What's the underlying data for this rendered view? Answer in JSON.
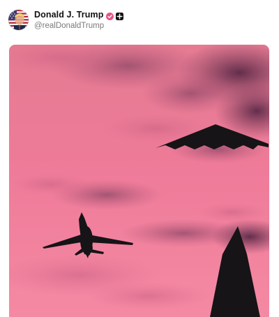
{
  "post": {
    "author": {
      "display_name": "Donald J. Trump",
      "handle": "@realDonaldTrump",
      "avatar_icon": "profile-avatar-flag",
      "verified_icon": "verified-badge-icon",
      "verified_color": "#e5538a",
      "app_badge_icon": "app-badge-icon"
    },
    "media": {
      "icon_names": [
        "b2-stealth-bomber-icon",
        "b1-bomber-icon",
        "obelisk-monument-icon"
      ],
      "sky_colors": [
        "#e57b92",
        "#f07a9a",
        "#f58aa4"
      ],
      "cloud_color": "#6b3350",
      "silhouette_color": "#161416"
    }
  }
}
